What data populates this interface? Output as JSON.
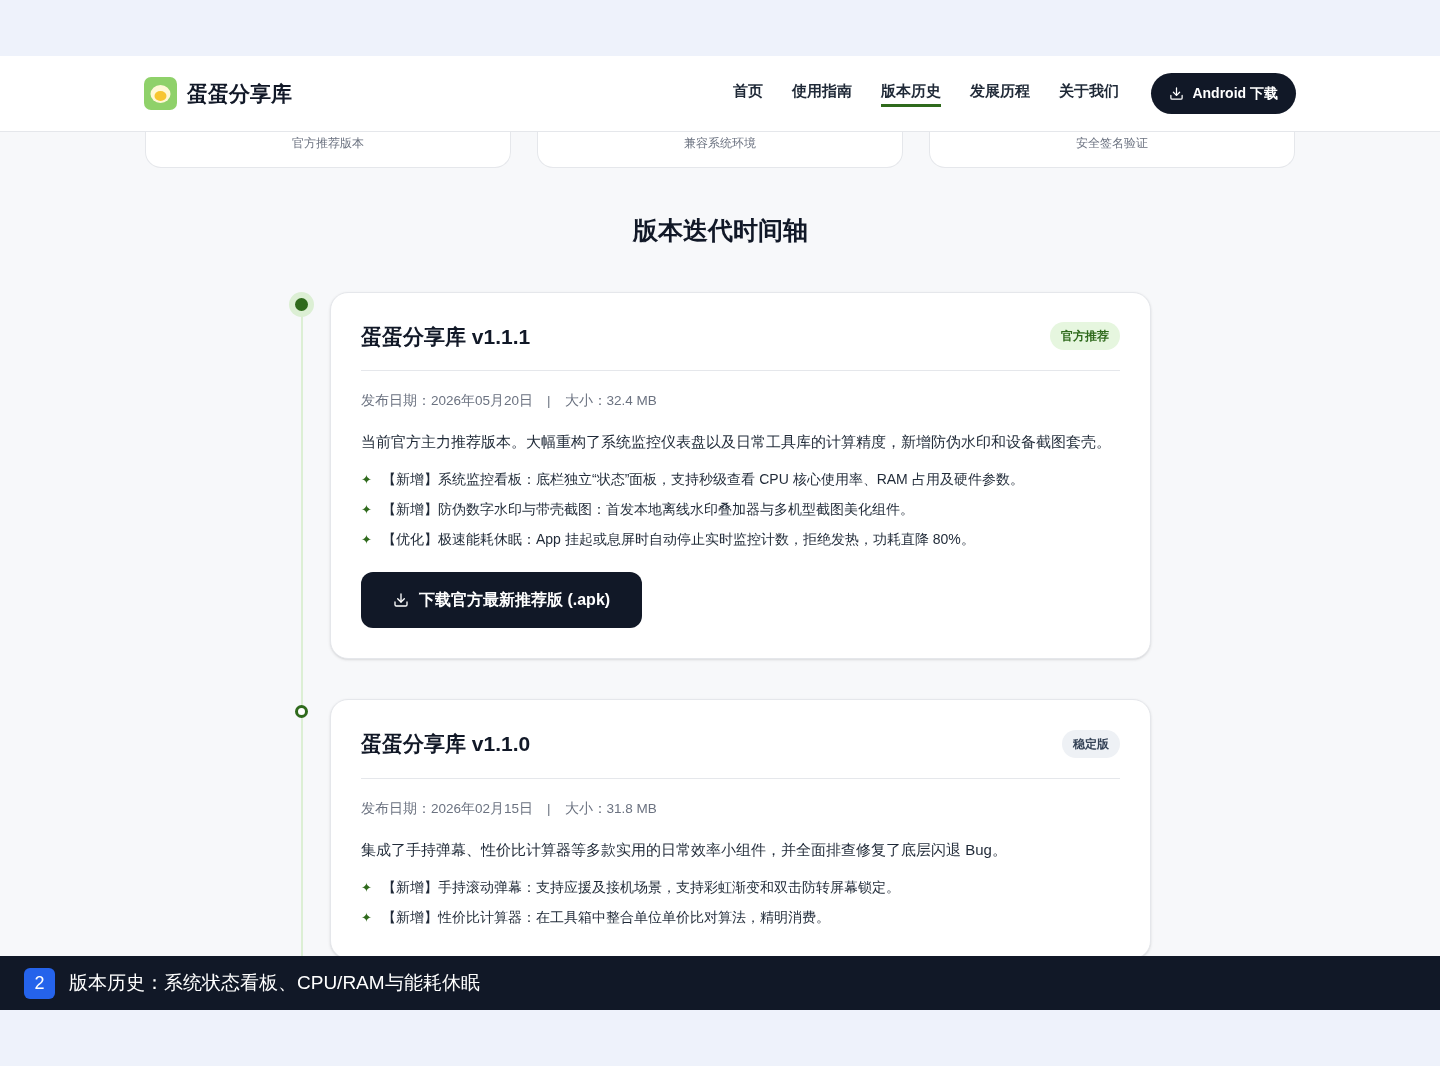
{
  "header": {
    "logo_text": "蛋蛋分享库",
    "nav": [
      {
        "label": "首页",
        "selected": false
      },
      {
        "label": "使用指南",
        "selected": false
      },
      {
        "label": "版本历史",
        "selected": true
      },
      {
        "label": "发展历程",
        "selected": false
      },
      {
        "label": "关于我们",
        "selected": false
      }
    ],
    "download_button": "Android 下载"
  },
  "feature_cards": [
    "官方推荐版本",
    "兼容系统环境",
    "安全签名验证"
  ],
  "section_title": "版本迭代时间轴",
  "versions": [
    {
      "title": "蛋蛋分享库 v1.1.1",
      "current": true,
      "badge": {
        "label": "官方推荐",
        "kind": "recommended"
      },
      "date": "发布日期：2026年05月20日",
      "separator": "|",
      "size": "大小：32.4 MB",
      "description": "当前官方主力推荐版本。大幅重构了系统监控仪表盘以及日常工具库的计算精度，新增防伪水印和设备截图套壳。",
      "bullet": "✦",
      "changes": [
        "【新增】系统监控看板：底栏独立“状态”面板，支持秒级查看 CPU 核心使用率、RAM 占用及硬件参数。",
        "【新增】防伪数字水印与带壳截图：首发本地离线水印叠加器与多机型截图美化组件。",
        "【优化】极速能耗休眠：App 挂起或息屏时自动停止实时监控计数，拒绝发热，功耗直降 80%。"
      ],
      "download_button": "下载官方最新推荐版 (.apk)"
    },
    {
      "title": "蛋蛋分享库 v1.1.0",
      "current": false,
      "badge": {
        "label": "稳定版",
        "kind": "stable"
      },
      "date": "发布日期：2026年02月15日",
      "separator": "|",
      "size": "大小：31.8 MB",
      "description": "集成了手持弹幕、性价比计算器等多款实用的日常效率小组件，并全面排查修复了底层闪退 Bug。",
      "bullet": "✦",
      "changes": [
        "【新增】手持滚动弹幕：支持应援及接机场景，支持彩虹渐变和双击防转屏幕锁定。",
        "【新增】性价比计算器：在工具箱中整合单位单价比对算法，精明消费。"
      ]
    }
  ],
  "caption": {
    "number": "2",
    "text": "版本历史：系统状态看板、CPU/RAM与能耗休眠"
  }
}
